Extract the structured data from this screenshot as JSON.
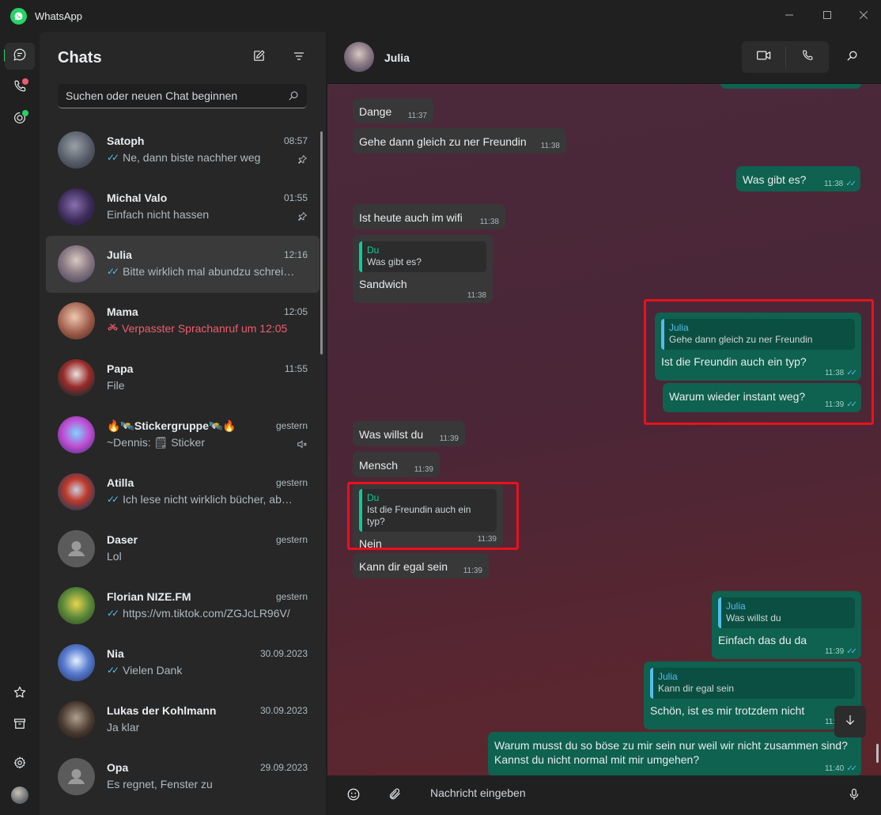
{
  "window": {
    "title": "WhatsApp"
  },
  "colors": {
    "accent": "#25d366",
    "outgoing": "#0f6150",
    "incoming": "#383838",
    "missed": "#f15c6d",
    "highlight": "#e8121c"
  },
  "rail": {
    "items": [
      {
        "name": "chats-icon",
        "badge": false
      },
      {
        "name": "calls-icon",
        "badge": "red"
      },
      {
        "name": "status-icon",
        "badge": "green"
      }
    ],
    "bottom": [
      "starred-icon",
      "archive-icon",
      "settings-icon",
      "profile-avatar"
    ]
  },
  "list": {
    "title": "Chats",
    "search_placeholder": "Suchen oder neuen Chat beginnen",
    "chats": [
      {
        "name": "Satoph",
        "time": "08:57",
        "preview": "Ne, dann biste nachher weg",
        "ticks": true,
        "meta": "pin"
      },
      {
        "name": "Michal Valo",
        "time": "01:55",
        "preview": "Einfach nicht hassen",
        "ticks": false,
        "meta": "pin"
      },
      {
        "name": "Julia",
        "time": "12:16",
        "preview": "Bitte wirklich mal abundzu schrei…",
        "ticks": true,
        "meta": ""
      },
      {
        "name": "Mama",
        "time": "12:05",
        "preview": "Verpasster Sprachanruf um 12:05",
        "ticks": false,
        "meta": "",
        "missed": true
      },
      {
        "name": "Papa",
        "time": "11:55",
        "preview": "File",
        "ticks": false,
        "meta": ""
      },
      {
        "name": "🔥🛰️Stickergruppe🛰️🔥",
        "time": "gestern",
        "preview": "~Dennis: 🗒 Sticker",
        "ticks": false,
        "meta": "mute"
      },
      {
        "name": "Atilla",
        "time": "gestern",
        "preview": "Ich lese nicht wirklich bücher, abe…",
        "ticks": true,
        "meta": ""
      },
      {
        "name": "Daser",
        "time": "gestern",
        "preview": "Lol",
        "ticks": false,
        "meta": "",
        "placeholder": true
      },
      {
        "name": "Florian NIZE.FM",
        "time": "gestern",
        "preview": "https://vm.tiktok.com/ZGJcLR96V/",
        "ticks": true,
        "meta": ""
      },
      {
        "name": "Nia",
        "time": "30.09.2023",
        "preview": "Vielen Dank",
        "ticks": true,
        "meta": ""
      },
      {
        "name": "Lukas der Kohlmann",
        "time": "30.09.2023",
        "preview": "Ja klar",
        "ticks": false,
        "meta": ""
      },
      {
        "name": "Opa",
        "time": "29.09.2023",
        "preview": "Es regnet, Fenster zu",
        "ticks": false,
        "meta": "",
        "placeholder": true
      }
    ]
  },
  "conversation": {
    "contact": "Julia",
    "messages": [
      {
        "dir": "in",
        "text": "Dange",
        "time": "11:37"
      },
      {
        "dir": "in",
        "text": "Gehe dann gleich zu ner Freundin",
        "time": "11:38"
      },
      {
        "dir": "out",
        "text": "Was gibt es?",
        "time": "11:38"
      },
      {
        "dir": "in",
        "text": "Ist heute auch im wifi",
        "time": "11:38"
      },
      {
        "dir": "in",
        "quote_author": "Du",
        "quote_text": "Was gibt es?",
        "text": "Sandwich",
        "time": "11:38"
      },
      {
        "dir": "out",
        "quote_author": "Julia",
        "quote_text": "Gehe dann gleich zu ner Freundin",
        "text": "Ist die Freundin auch ein typ?",
        "time": "11:38"
      },
      {
        "dir": "out",
        "text": "Warum wieder instant weg?",
        "time": "11:39"
      },
      {
        "dir": "in",
        "text": "Was willst du",
        "time": "11:39"
      },
      {
        "dir": "in",
        "text": "Mensch",
        "time": "11:39"
      },
      {
        "dir": "in",
        "quote_author": "Du",
        "quote_text": "Ist die Freundin auch ein typ?",
        "text": "Nein",
        "time": "11:39"
      },
      {
        "dir": "in",
        "text": "Kann dir egal sein",
        "time": "11:39"
      },
      {
        "dir": "out",
        "quote_author": "Julia",
        "quote_text": "Was willst du",
        "text": "Einfach das du da",
        "time": "11:39"
      },
      {
        "dir": "out",
        "quote_author": "Julia",
        "quote_text": "Kann dir egal sein",
        "text": "Schön, ist es mir trotzdem nicht",
        "time": "11:39"
      },
      {
        "dir": "out",
        "text": "Warum musst du so böse zu mir sein nur weil wir nicht zusammen sind? Kannst du nicht normal mit mir umgehen?",
        "time": "11:40"
      }
    ],
    "composer_placeholder": "Nachricht eingeben"
  }
}
